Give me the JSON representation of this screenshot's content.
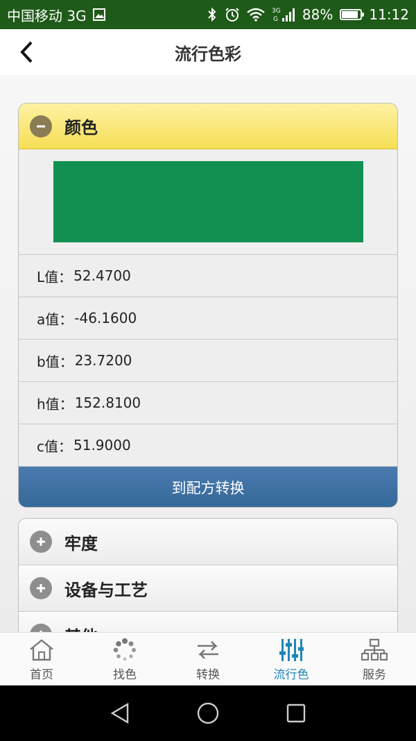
{
  "status_bar": {
    "carrier": "中国移动 3G",
    "battery": "88%",
    "battery_level": 0.88,
    "time": "11:12",
    "network_badge_top": "3G",
    "network_badge_bottom": "G"
  },
  "header": {
    "title": "流行色彩"
  },
  "color_panel": {
    "title": "颜色",
    "swatch_color": "#129052",
    "rows": [
      {
        "label": "L值：",
        "value": "52.4700"
      },
      {
        "label": "a值：",
        "value": "-46.1600"
      },
      {
        "label": "b值：",
        "value": "23.7200"
      },
      {
        "label": "h值：",
        "value": "152.8100"
      },
      {
        "label": "c值：",
        "value": "51.9000"
      }
    ],
    "button_label": "到配方转换"
  },
  "collapsed_sections": [
    {
      "title": "牢度"
    },
    {
      "title": "设备与工艺"
    },
    {
      "title": "其他"
    }
  ],
  "tabs": [
    {
      "label": "首页",
      "icon": "home-icon"
    },
    {
      "label": "找色",
      "icon": "dots-spinner-icon"
    },
    {
      "label": "转换",
      "icon": "swap-arrows-icon"
    },
    {
      "label": "流行色",
      "icon": "sliders-icon",
      "active": true
    },
    {
      "label": "服务",
      "icon": "network-icon"
    }
  ],
  "colors": {
    "status_bar": "#1e5a18",
    "accent_active_tab": "#1f86b7",
    "button_blue": "#3b6fa3",
    "active_header_yellow": "#f7de55"
  }
}
